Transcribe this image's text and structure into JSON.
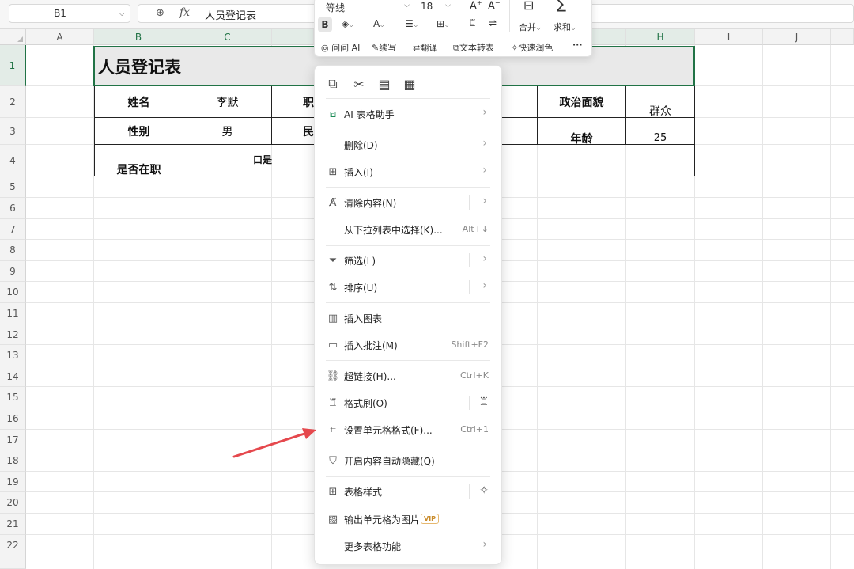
{
  "formula_bar": {
    "name_box": "B1",
    "fx_symbol": "fx",
    "formula_value": "人员登记表"
  },
  "columns": [
    "A",
    "B",
    "C",
    "D",
    "E",
    "F",
    "G",
    "H",
    "I",
    "J"
  ],
  "rows": [
    "1",
    "2",
    "3",
    "4",
    "5",
    "6",
    "7",
    "8",
    "9",
    "10",
    "11",
    "12",
    "13",
    "14",
    "15",
    "16",
    "17",
    "18",
    "19",
    "20",
    "21",
    "22"
  ],
  "sheet": {
    "title": "人员登记表",
    "name_label": "姓名",
    "name_value": "李默",
    "position_label_partial": "职",
    "political_label": "政治面貌",
    "political_value": "群众",
    "gender_label": "性别",
    "gender_value": "男",
    "ethnic_label_partial": "民",
    "age_label": "年龄",
    "age_value": "25",
    "employed_label": "是否在职",
    "employed_option": "口是"
  },
  "mini_toolbar": {
    "font_name": "等线",
    "font_size": "18",
    "bold": "B",
    "merge_label": "合并",
    "sum_label": "求和",
    "ai_ask": "问问 AI",
    "continue_write": "续写",
    "translate": "翻译",
    "text_convert": "文本转表",
    "quick_polish": "快速润色",
    "more": "···"
  },
  "context_menu": {
    "items": [
      {
        "label": "AI 表格助手",
        "shortcut": "",
        "submenu": true
      },
      {
        "label": "删除(D)",
        "shortcut": "",
        "submenu": true
      },
      {
        "label": "插入(I)",
        "shortcut": "",
        "submenu": true
      },
      {
        "label": "清除内容(N)",
        "shortcut": "",
        "submenu": true
      },
      {
        "label": "从下拉列表中选择(K)...",
        "shortcut": "Alt+↓",
        "submenu": false
      },
      {
        "label": "筛选(L)",
        "shortcut": "",
        "submenu": true
      },
      {
        "label": "排序(U)",
        "shortcut": "",
        "submenu": true
      },
      {
        "label": "插入图表",
        "shortcut": "",
        "submenu": false
      },
      {
        "label": "插入批注(M)",
        "shortcut": "Shift+F2",
        "submenu": false
      },
      {
        "label": "超链接(H)...",
        "shortcut": "Ctrl+K",
        "submenu": false
      },
      {
        "label": "格式刷(O)",
        "shortcut": "",
        "submenu": false
      },
      {
        "label": "设置单元格格式(F)...",
        "shortcut": "Ctrl+1",
        "submenu": false
      },
      {
        "label": "开启内容自动隐藏(Q)",
        "shortcut": "",
        "submenu": false
      },
      {
        "label": "表格样式",
        "shortcut": "",
        "submenu": false
      },
      {
        "label": "输出单元格为图片",
        "shortcut": "",
        "submenu": false
      },
      {
        "label": "更多表格功能",
        "shortcut": "",
        "submenu": true
      }
    ],
    "vip_badge": "VIP"
  },
  "colors": {
    "selection": "#217346",
    "arrow": "#e5484d"
  }
}
